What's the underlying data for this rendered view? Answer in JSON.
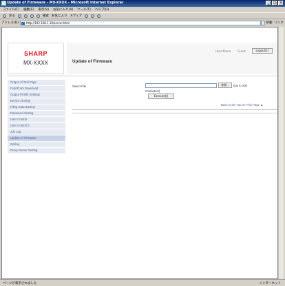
{
  "browser": {
    "title": "Update of Firmware - MX-XXXX - Microsoft Internet Explorer",
    "menu": [
      "ファイル(F)",
      "編集(E)",
      "表示(V)",
      "お気に入り(A)",
      "ツール(T)",
      "ヘルプ(H)"
    ],
    "toolbar": [
      "戻る",
      "検索",
      "お気に入り",
      "メディア"
    ],
    "address_label": "アドレス(D)",
    "address": "http://192.168.1.10/server.html",
    "go_label": "移動",
    "links_label": "リンク",
    "status_text": "ページが表示されました",
    "zone_text": "インターネット"
  },
  "page": {
    "logo_brand": "SHARP",
    "model": "MX-XXXX",
    "title": "Update of Firmware",
    "user_name_label": "User Name",
    "user_name": "Guest",
    "logout_label": "Logout(L)",
    "sidebar": [
      "Output of Test Page",
      "Font/Form Download",
      "Output Profile Settings",
      "Device Cloning",
      "Filing Data Backup",
      "Password Setting",
      "User Control",
      "User Control 2",
      "Job Log",
      "Update of Firmware",
      "Syslog",
      "Proxy Server Setting"
    ],
    "select_file_label": "Select File",
    "browse_label": "参照...",
    "limit_note_1": "(Up to 200",
    "limit_note_2": "characters)",
    "execute_label": "Execute(J)",
    "back_link": "Back to the Top on This Page ▲"
  }
}
